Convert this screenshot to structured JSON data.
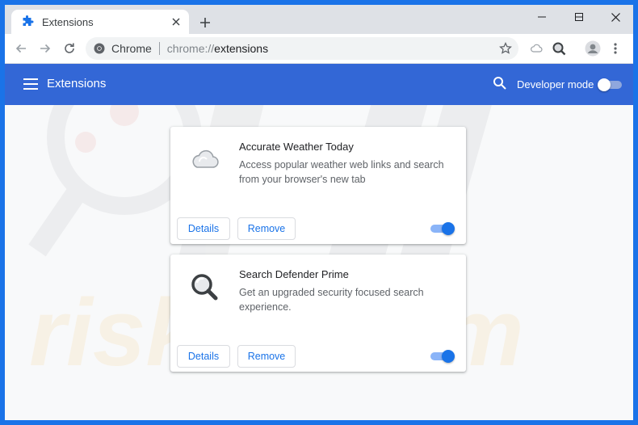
{
  "browser": {
    "tab_title": "Extensions",
    "site_name": "Chrome",
    "url_scheme": "chrome://",
    "url_path": "extensions"
  },
  "header": {
    "title": "Extensions",
    "developer_mode_label": "Developer mode",
    "developer_mode_on": false
  },
  "extensions": [
    {
      "name": "Accurate Weather Today",
      "description": "Access popular weather web links and search from your browser's new tab",
      "icon": "cloud-icon",
      "enabled": true,
      "details_label": "Details",
      "remove_label": "Remove"
    },
    {
      "name": "Search Defender Prime",
      "description": "Get an upgraded security focused search experience.",
      "icon": "magnifier-icon",
      "enabled": true,
      "details_label": "Details",
      "remove_label": "Remove"
    }
  ],
  "colors": {
    "header_blue": "#3367d6",
    "accent_blue": "#1a73e8",
    "window_border": "#1a73e8"
  }
}
